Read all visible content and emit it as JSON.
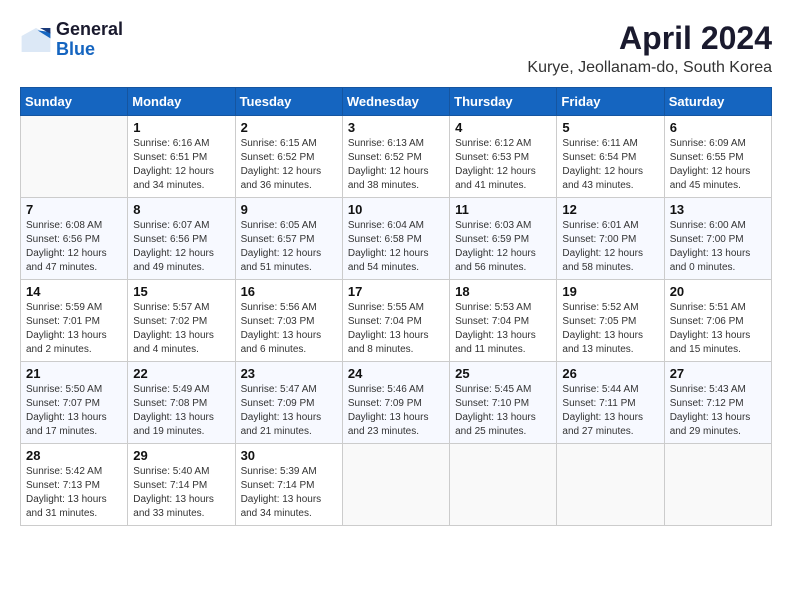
{
  "header": {
    "logo_general": "General",
    "logo_blue": "Blue",
    "month_title": "April 2024",
    "location": "Kurye, Jeollanam-do, South Korea"
  },
  "weekdays": [
    "Sunday",
    "Monday",
    "Tuesday",
    "Wednesday",
    "Thursday",
    "Friday",
    "Saturday"
  ],
  "weeks": [
    [
      {
        "day": "",
        "info": ""
      },
      {
        "day": "1",
        "info": "Sunrise: 6:16 AM\nSunset: 6:51 PM\nDaylight: 12 hours\nand 34 minutes."
      },
      {
        "day": "2",
        "info": "Sunrise: 6:15 AM\nSunset: 6:52 PM\nDaylight: 12 hours\nand 36 minutes."
      },
      {
        "day": "3",
        "info": "Sunrise: 6:13 AM\nSunset: 6:52 PM\nDaylight: 12 hours\nand 38 minutes."
      },
      {
        "day": "4",
        "info": "Sunrise: 6:12 AM\nSunset: 6:53 PM\nDaylight: 12 hours\nand 41 minutes."
      },
      {
        "day": "5",
        "info": "Sunrise: 6:11 AM\nSunset: 6:54 PM\nDaylight: 12 hours\nand 43 minutes."
      },
      {
        "day": "6",
        "info": "Sunrise: 6:09 AM\nSunset: 6:55 PM\nDaylight: 12 hours\nand 45 minutes."
      }
    ],
    [
      {
        "day": "7",
        "info": "Sunrise: 6:08 AM\nSunset: 6:56 PM\nDaylight: 12 hours\nand 47 minutes."
      },
      {
        "day": "8",
        "info": "Sunrise: 6:07 AM\nSunset: 6:56 PM\nDaylight: 12 hours\nand 49 minutes."
      },
      {
        "day": "9",
        "info": "Sunrise: 6:05 AM\nSunset: 6:57 PM\nDaylight: 12 hours\nand 51 minutes."
      },
      {
        "day": "10",
        "info": "Sunrise: 6:04 AM\nSunset: 6:58 PM\nDaylight: 12 hours\nand 54 minutes."
      },
      {
        "day": "11",
        "info": "Sunrise: 6:03 AM\nSunset: 6:59 PM\nDaylight: 12 hours\nand 56 minutes."
      },
      {
        "day": "12",
        "info": "Sunrise: 6:01 AM\nSunset: 7:00 PM\nDaylight: 12 hours\nand 58 minutes."
      },
      {
        "day": "13",
        "info": "Sunrise: 6:00 AM\nSunset: 7:00 PM\nDaylight: 13 hours\nand 0 minutes."
      }
    ],
    [
      {
        "day": "14",
        "info": "Sunrise: 5:59 AM\nSunset: 7:01 PM\nDaylight: 13 hours\nand 2 minutes."
      },
      {
        "day": "15",
        "info": "Sunrise: 5:57 AM\nSunset: 7:02 PM\nDaylight: 13 hours\nand 4 minutes."
      },
      {
        "day": "16",
        "info": "Sunrise: 5:56 AM\nSunset: 7:03 PM\nDaylight: 13 hours\nand 6 minutes."
      },
      {
        "day": "17",
        "info": "Sunrise: 5:55 AM\nSunset: 7:04 PM\nDaylight: 13 hours\nand 8 minutes."
      },
      {
        "day": "18",
        "info": "Sunrise: 5:53 AM\nSunset: 7:04 PM\nDaylight: 13 hours\nand 11 minutes."
      },
      {
        "day": "19",
        "info": "Sunrise: 5:52 AM\nSunset: 7:05 PM\nDaylight: 13 hours\nand 13 minutes."
      },
      {
        "day": "20",
        "info": "Sunrise: 5:51 AM\nSunset: 7:06 PM\nDaylight: 13 hours\nand 15 minutes."
      }
    ],
    [
      {
        "day": "21",
        "info": "Sunrise: 5:50 AM\nSunset: 7:07 PM\nDaylight: 13 hours\nand 17 minutes."
      },
      {
        "day": "22",
        "info": "Sunrise: 5:49 AM\nSunset: 7:08 PM\nDaylight: 13 hours\nand 19 minutes."
      },
      {
        "day": "23",
        "info": "Sunrise: 5:47 AM\nSunset: 7:09 PM\nDaylight: 13 hours\nand 21 minutes."
      },
      {
        "day": "24",
        "info": "Sunrise: 5:46 AM\nSunset: 7:09 PM\nDaylight: 13 hours\nand 23 minutes."
      },
      {
        "day": "25",
        "info": "Sunrise: 5:45 AM\nSunset: 7:10 PM\nDaylight: 13 hours\nand 25 minutes."
      },
      {
        "day": "26",
        "info": "Sunrise: 5:44 AM\nSunset: 7:11 PM\nDaylight: 13 hours\nand 27 minutes."
      },
      {
        "day": "27",
        "info": "Sunrise: 5:43 AM\nSunset: 7:12 PM\nDaylight: 13 hours\nand 29 minutes."
      }
    ],
    [
      {
        "day": "28",
        "info": "Sunrise: 5:42 AM\nSunset: 7:13 PM\nDaylight: 13 hours\nand 31 minutes."
      },
      {
        "day": "29",
        "info": "Sunrise: 5:40 AM\nSunset: 7:14 PM\nDaylight: 13 hours\nand 33 minutes."
      },
      {
        "day": "30",
        "info": "Sunrise: 5:39 AM\nSunset: 7:14 PM\nDaylight: 13 hours\nand 34 minutes."
      },
      {
        "day": "",
        "info": ""
      },
      {
        "day": "",
        "info": ""
      },
      {
        "day": "",
        "info": ""
      },
      {
        "day": "",
        "info": ""
      }
    ]
  ]
}
